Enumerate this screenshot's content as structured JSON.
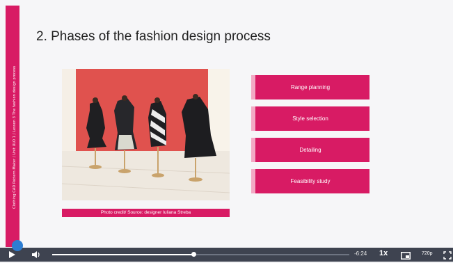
{
  "slide": {
    "title": "2. Phases of the fashion design process",
    "side_text": "Clothing CAD Pattern Maker / Unit ULO 1 / Lesson 3 The fashion design process",
    "photo_alt": "photo-mannequins-dresses",
    "photo_credit": "Photo credit/ Source:  designer Iuliana Streba",
    "phases": [
      {
        "label": "Range planning"
      },
      {
        "label": "Style selection"
      },
      {
        "label": "Detailing"
      },
      {
        "label": "Feasibility study"
      }
    ]
  },
  "player": {
    "time": "-6:24",
    "speed": "1x",
    "quality": "720p",
    "progress": 0.475,
    "icons": [
      "play-icon",
      "volume-icon",
      "pip-icon",
      "fullscreen-icon"
    ]
  },
  "colors": {
    "accent": "#d81b64",
    "accent_light": "#f3a9c4",
    "player_bar": "#3e4350",
    "wall": "#e0524e"
  }
}
